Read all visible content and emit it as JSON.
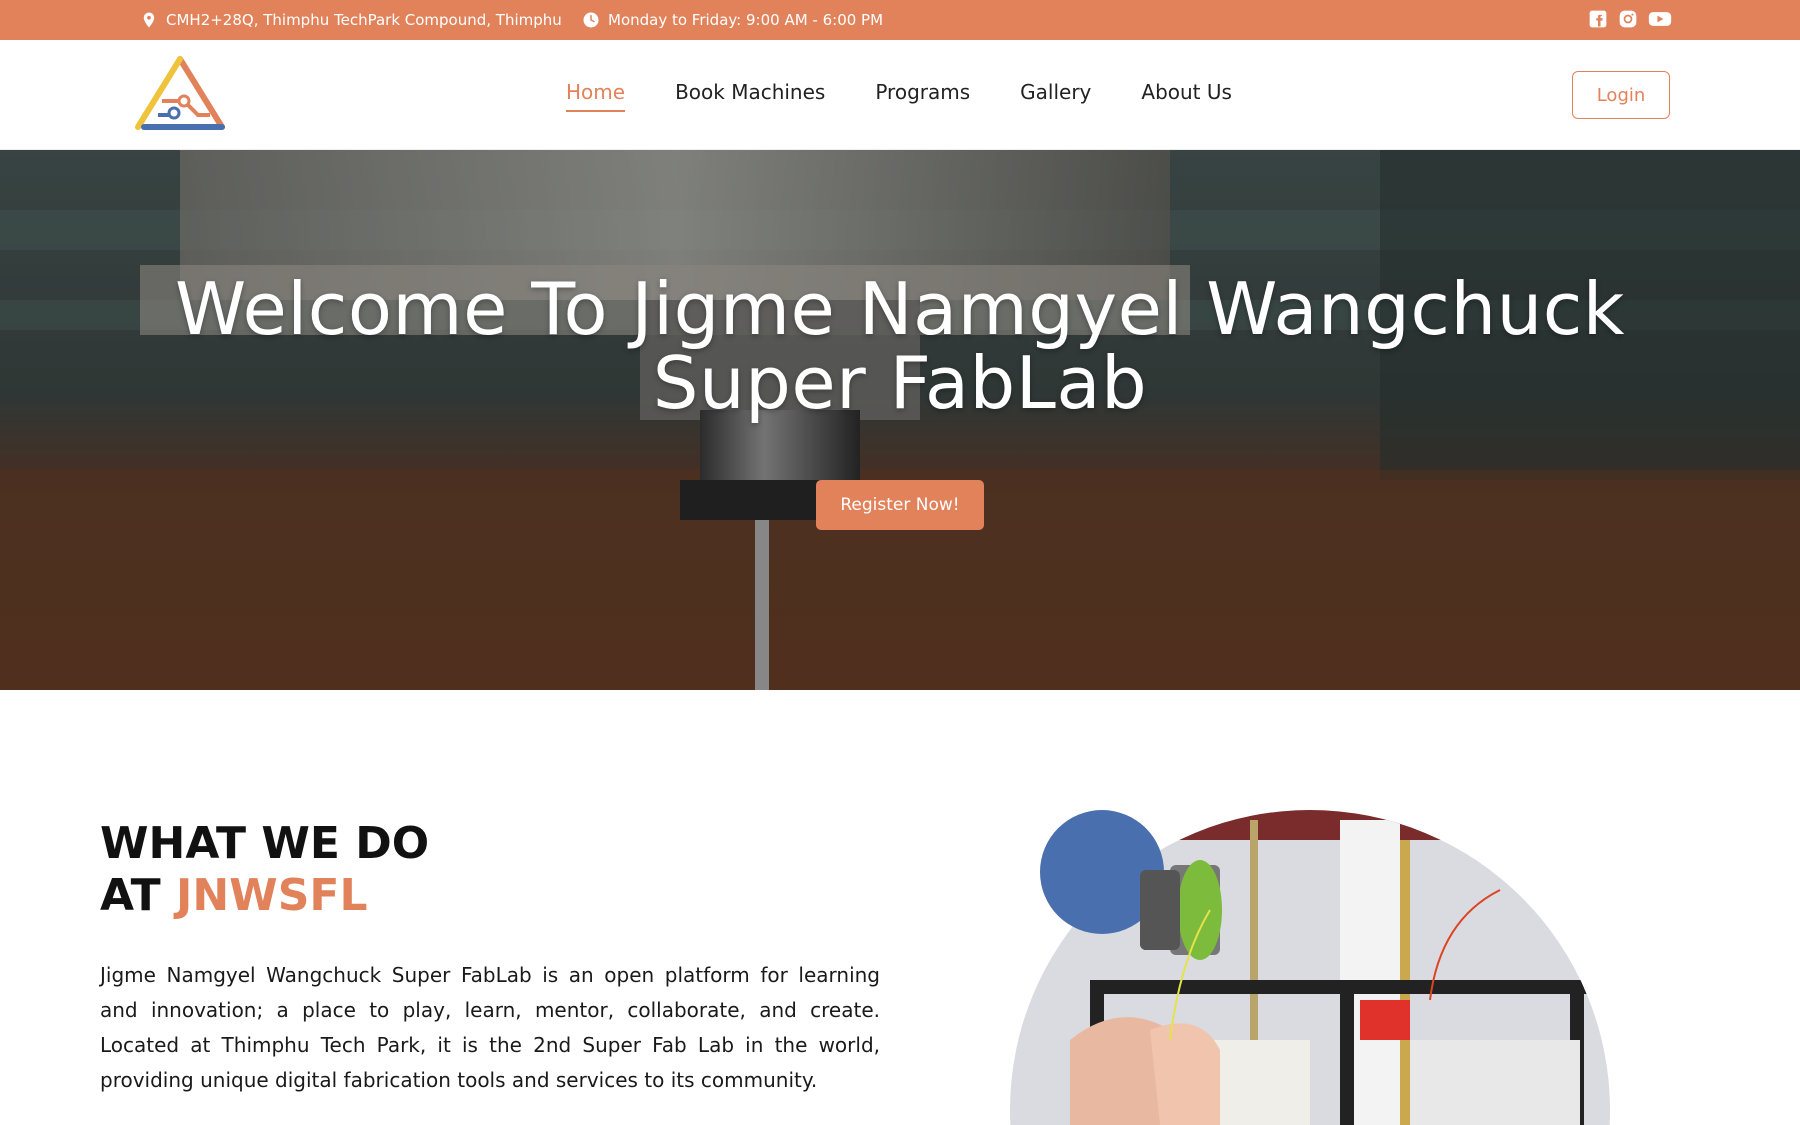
{
  "topbar": {
    "address": "CMH2+28Q, Thimphu TechPark Compound, Thimphu",
    "hours": "Monday to Friday: 9:00 AM - 6:00 PM",
    "social": [
      "facebook-icon",
      "instagram-icon",
      "youtube-icon"
    ]
  },
  "nav": {
    "items": [
      "Home",
      "Book Machines",
      "Programs",
      "Gallery",
      "About Us"
    ],
    "active": "Home",
    "login_label": "Login"
  },
  "hero": {
    "title_line1": "Welcome To Jigme Namgyel Wangchuck",
    "title_line2": "Super FabLab",
    "cta_label": "Register Now!"
  },
  "about": {
    "title_line1": "WHAT WE DO",
    "title_prefix": "AT",
    "title_accent": "JNWSFL",
    "body": "Jigme Namgyel Wangchuck Super FabLab is an open platform for learning and innovation; a place to play, learn, mentor, collaborate, and create. Located at Thimphu Tech Park, it is the 2nd Super Fab Lab in the world, providing unique digital fabrication tools and services to its community."
  },
  "colors": {
    "accent": "#e1825b",
    "decor_circle": "#4a6fae"
  }
}
